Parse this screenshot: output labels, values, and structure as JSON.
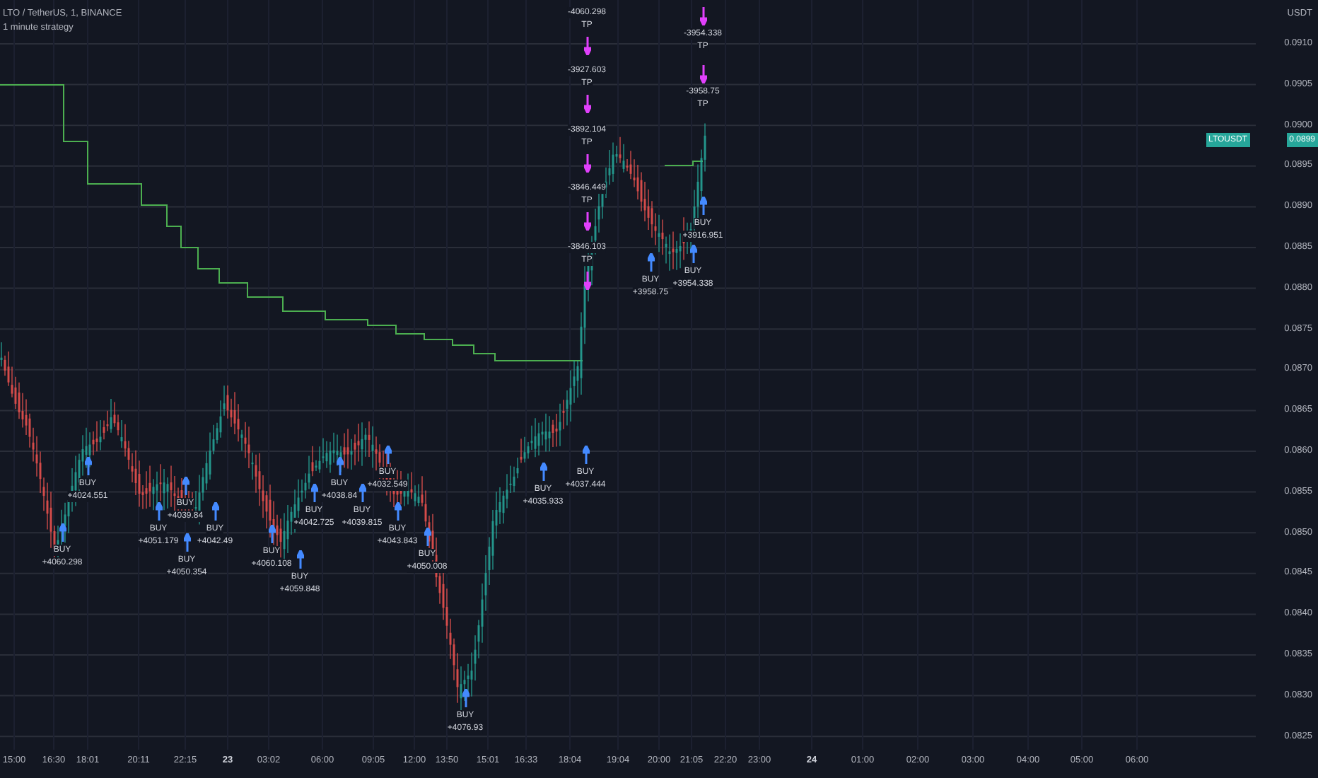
{
  "header": {
    "symbol": "LTO / TetherUS, 1, BINANCE",
    "strategy": "1 minute strategy"
  },
  "price_axis": {
    "currency": "USDT",
    "ticks": [
      "0.0910",
      "0.0905",
      "0.0900",
      "0.0895",
      "0.0890",
      "0.0885",
      "0.0880",
      "0.0875",
      "0.0870",
      "0.0865",
      "0.0860",
      "0.0855",
      "0.0850",
      "0.0845",
      "0.0840",
      "0.0835",
      "0.0830",
      "0.0825"
    ]
  },
  "price_tag": {
    "symbol": "LTOUSDT",
    "price": "0.0899"
  },
  "tp_labels": [
    {
      "value": "-4060.298",
      "signal": "TP"
    },
    {
      "value": "-3927.603",
      "signal": "TP"
    },
    {
      "value": "-3892.104",
      "signal": "TP"
    },
    {
      "value": "-3846.449",
      "signal": "TP"
    },
    {
      "value": "-3846.103",
      "signal": "TP"
    },
    {
      "value": "-3954.338",
      "signal": "TP"
    },
    {
      "value": "-3958.75",
      "signal": "TP"
    }
  ],
  "buy_labels": [
    {
      "signal": "BUY",
      "value": "+3916.951"
    },
    {
      "signal": "BUY",
      "value": "+3954.338"
    },
    {
      "signal": "BUY",
      "value": "+3958.75"
    },
    {
      "signal": "BUY",
      "value": "+4032.549"
    },
    {
      "signal": "BUY",
      "value": "+4037.444"
    },
    {
      "signal": "BUY",
      "value": "+4024.551"
    },
    {
      "signal": "BUY",
      "value": "+4038.84"
    },
    {
      "signal": "BUY",
      "value": "+4035.933"
    },
    {
      "signal": "BUY",
      "value": "+4039.84"
    },
    {
      "signal": "BUY",
      "value": "+4042.725"
    },
    {
      "signal": "BUY",
      "value": "+4039.815"
    },
    {
      "signal": "BUY",
      "value": "+4051.179"
    },
    {
      "signal": "BUY",
      "value": "+4042.49"
    },
    {
      "signal": "BUY",
      "value": "+4043.843"
    },
    {
      "signal": "BUY",
      "value": "+4060.298"
    },
    {
      "signal": "BUY",
      "value": "+4060.108"
    },
    {
      "signal": "BUY",
      "value": "+4050.008"
    },
    {
      "signal": "BUY",
      "value": "+4050.354"
    },
    {
      "signal": "BUY",
      "value": "+4059.848"
    },
    {
      "signal": "BUY",
      "value": "+4076.93"
    }
  ],
  "time_axis": [
    {
      "label": "15:00",
      "kind": "time"
    },
    {
      "label": "16:30",
      "kind": "time"
    },
    {
      "label": "18:01",
      "kind": "time"
    },
    {
      "label": "20:11",
      "kind": "time"
    },
    {
      "label": "22:15",
      "kind": "time"
    },
    {
      "label": "23",
      "kind": "day"
    },
    {
      "label": "03:02",
      "kind": "time"
    },
    {
      "label": "06:00",
      "kind": "time"
    },
    {
      "label": "09:05",
      "kind": "time"
    },
    {
      "label": "12:00",
      "kind": "time"
    },
    {
      "label": "13:50",
      "kind": "time"
    },
    {
      "label": "15:01",
      "kind": "time"
    },
    {
      "label": "16:33",
      "kind": "time"
    },
    {
      "label": "18:04",
      "kind": "time"
    },
    {
      "label": "19:04",
      "kind": "time"
    },
    {
      "label": "20:00",
      "kind": "time"
    },
    {
      "label": "21:05",
      "kind": "time"
    },
    {
      "label": "22:20",
      "kind": "time"
    },
    {
      "label": "23:00",
      "kind": "time"
    },
    {
      "label": "24",
      "kind": "day"
    },
    {
      "label": "01:00",
      "kind": "time"
    },
    {
      "label": "02:00",
      "kind": "time"
    },
    {
      "label": "03:00",
      "kind": "time"
    },
    {
      "label": "04:00",
      "kind": "time"
    },
    {
      "label": "05:00",
      "kind": "time"
    },
    {
      "label": "06:00",
      "kind": "time"
    }
  ]
}
